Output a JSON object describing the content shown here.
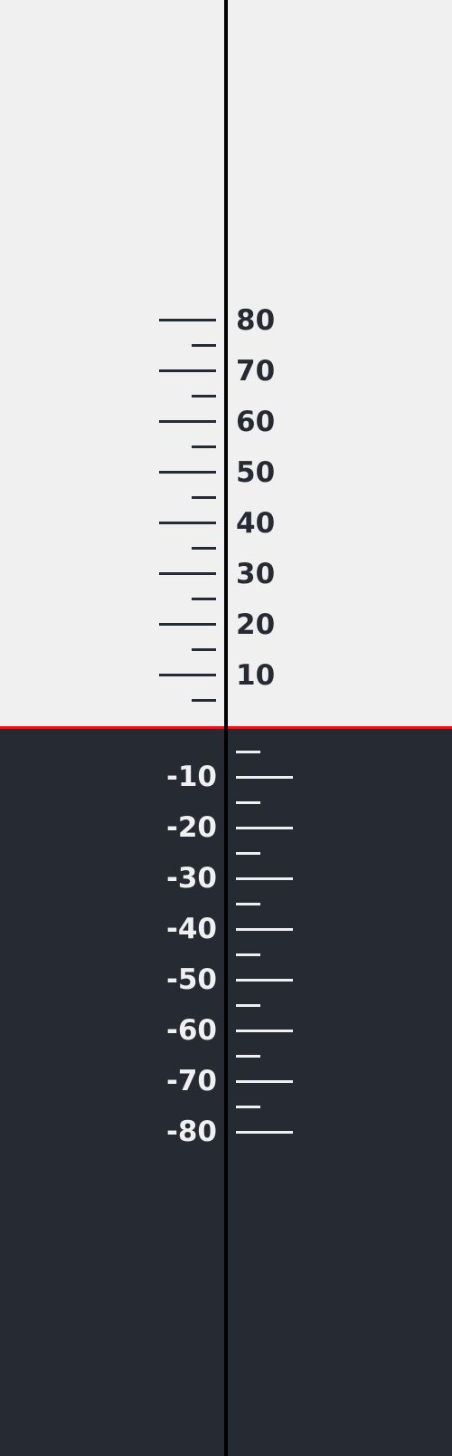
{
  "scale": {
    "positive_labels": [
      "80",
      "70",
      "60",
      "50",
      "40",
      "30",
      "20",
      "10"
    ],
    "negative_labels": [
      "-10",
      "-20",
      "-30",
      "-40",
      "-50",
      "-60",
      "-70",
      "-80"
    ]
  },
  "colors": {
    "sky": "#f0f0f0",
    "ground": "#262b33",
    "horizon": "#e0161c",
    "center_line": "#000000"
  }
}
